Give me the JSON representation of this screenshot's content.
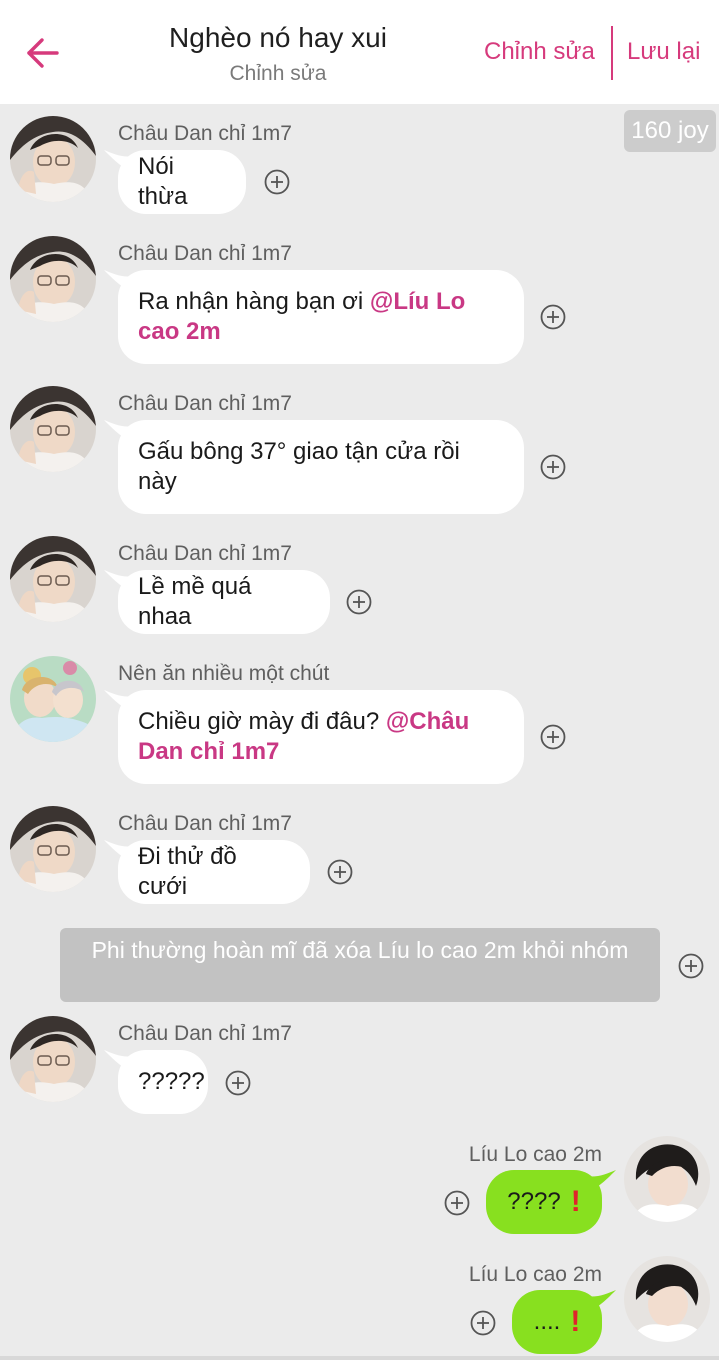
{
  "header": {
    "title": "Nghèo nó hay xui",
    "subtitle": "Chỉnh sửa",
    "edit_label": "Chỉnh sửa",
    "save_label": "Lưu lại",
    "accent_color": "#d63a7c"
  },
  "joy_badge": "160 joy",
  "messages": [
    {
      "sender": "Châu Dan chỉ 1m7",
      "text": "Nói thừa"
    },
    {
      "sender": "Châu Dan chỉ 1m7",
      "text": "Ra nhận hàng bạn ơi ",
      "mention": "@Líu Lo cao 2m"
    },
    {
      "sender": "Châu Dan chỉ 1m7",
      "text": "Gấu bông 37° giao tận cửa rồi này"
    },
    {
      "sender": "Châu Dan chỉ 1m7",
      "text": "Lề mề quá nhaa"
    },
    {
      "sender": "Nên ăn nhiều một chút",
      "text": "Chiều giờ mày đi đâu? ",
      "mention": "@Châu Dan chỉ 1m7"
    },
    {
      "sender": "Châu Dan chỉ 1m7",
      "text": "Đi thử đồ cưới"
    },
    {
      "sender": "Châu Dan chỉ 1m7",
      "text": "?????"
    },
    {
      "sender": "Líu Lo cao 2m",
      "text": "????"
    },
    {
      "sender": "Líu Lo cao 2m",
      "text": "...."
    }
  ],
  "system_message": "Phi thường hoàn mĩ đã xóa Líu lo cao 2m khỏi nhóm",
  "icons": {
    "back": "back-arrow-icon",
    "add_reaction": "plus-circle-icon",
    "exclamation": "red-exclamation-icon"
  },
  "colors": {
    "incoming_bubble": "#ffffff",
    "outgoing_bubble": "#88e01f",
    "mention": "#c93884",
    "background": "#ebebeb"
  }
}
